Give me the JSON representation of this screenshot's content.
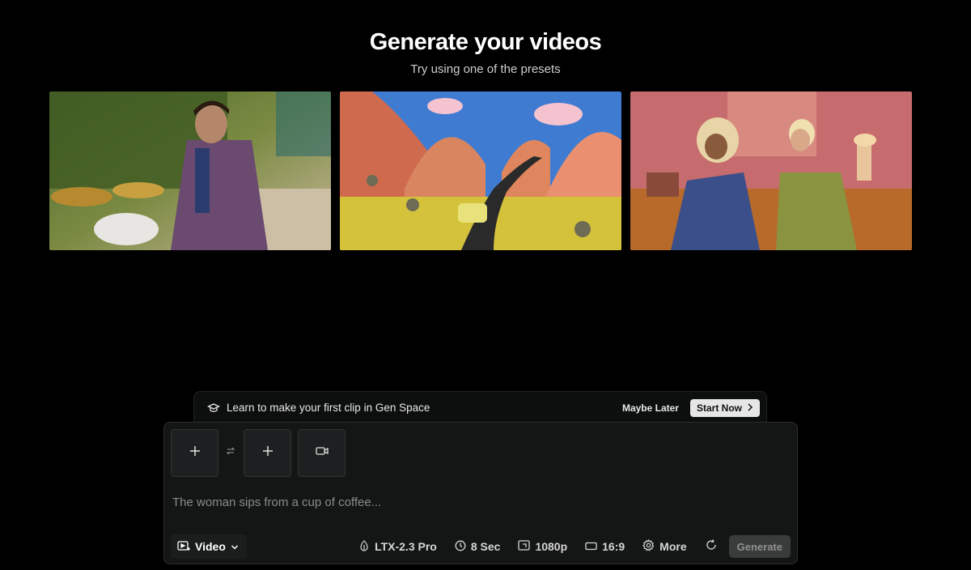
{
  "hero": {
    "title": "Generate your videos",
    "subtitle": "Try using one of the presets"
  },
  "presets": [
    {
      "icon": "drummer-thumbnail"
    },
    {
      "icon": "road-hills-thumbnail"
    },
    {
      "icon": "two-women-thumbnail"
    }
  ],
  "banner": {
    "text": "Learn to make your first clip in Gen Space",
    "maybe_later": "Maybe Later",
    "start_now": "Start Now"
  },
  "composer": {
    "prompt_placeholder": "The woman sips from a cup of coffee...",
    "mode": "Video",
    "model": "LTX-2.3 Pro",
    "duration": "8 Sec",
    "resolution": "1080p",
    "aspect": "16:9",
    "more": "More",
    "generate": "Generate"
  },
  "colors": {
    "background": "#000000",
    "panel": "#141616",
    "button_light": "#e6e6e6",
    "generate_disabled": "#3a3c3c"
  }
}
